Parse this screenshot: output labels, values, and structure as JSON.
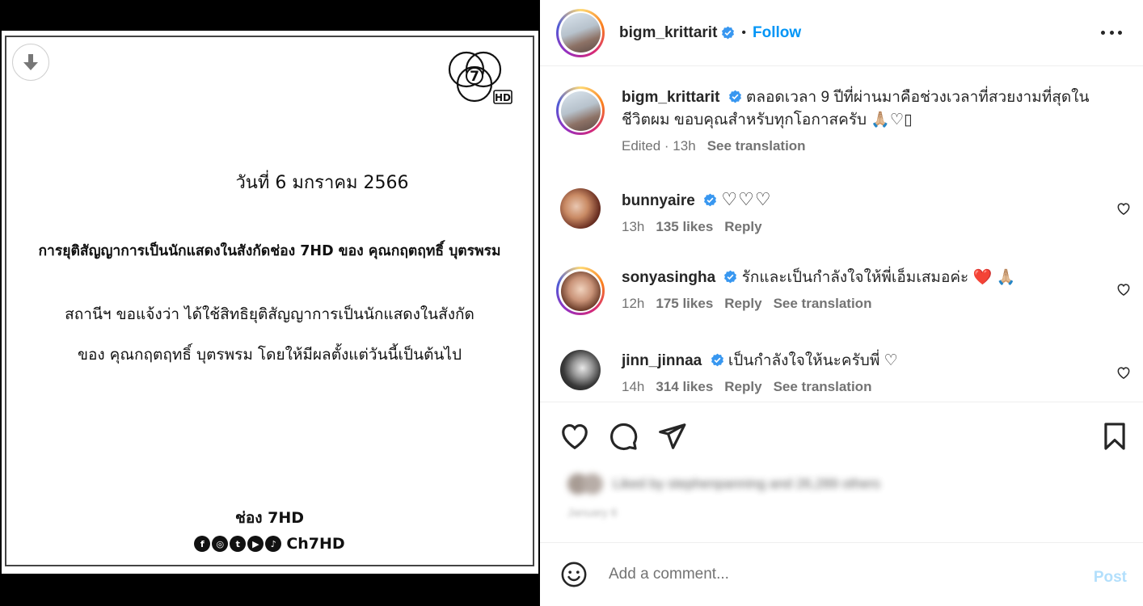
{
  "media": {
    "download_icon": "arrow-down-icon",
    "logo_text": "7",
    "logo_sub": "HD",
    "date_line": "วันที่ 6 มกราคม 2566",
    "heading": "การยุติสัญญาการเป็นนักแสดงในสังกัดช่อง 7HD ของ คุณกฤตฤทธิ์ บุตรพรม",
    "body_line_1": "สถานีฯ ขอแจ้งว่า ได้ใช้สิทธิยุติสัญญาการเป็นนักแสดงในสังกัด",
    "body_line_2": "ของ คุณกฤตฤทธิ์ บุตรพรม โดยให้มีผลตั้งแต่วันนี้เป็นต้นไป",
    "signature": "ช่อง 7HD",
    "social_icons": [
      {
        "name": "facebook-icon",
        "glyph": "f"
      },
      {
        "name": "instagram-icon",
        "glyph": "◎"
      },
      {
        "name": "twitter-icon",
        "glyph": "t"
      },
      {
        "name": "youtube-icon",
        "glyph": "▶"
      },
      {
        "name": "tiktok-icon",
        "glyph": "♪"
      }
    ],
    "social_handle": "Ch7HD"
  },
  "header": {
    "username": "bigm_krittarit",
    "separator": "•",
    "follow_label": "Follow"
  },
  "caption": {
    "username": "bigm_krittarit",
    "text": "ตลอดเวลา 9 ปีที่ผ่านมาคือช่วงเวลาที่สวยงามที่สุดในชีวิตผม ขอบคุณสำหรับทุกโอกาสครับ 🙏🏼♡▯",
    "edited": "Edited · 13h",
    "see_translation": "See translation"
  },
  "comments": [
    {
      "username": "bunnyaire",
      "text": "♡♡♡",
      "time": "13h",
      "likes": "135 likes",
      "reply": "Reply",
      "see_translation": ""
    },
    {
      "username": "sonyasingha",
      "text": "รักและเป็นกำลังใจให้พี่เอ็มเสมอค่ะ ❤️ 🙏🏼",
      "time": "12h",
      "likes": "175 likes",
      "reply": "Reply",
      "see_translation": "See translation"
    },
    {
      "username": "jinn_jinnaa",
      "text": "เป็นกำลังใจให้นะครับพี่ ♡",
      "time": "14h",
      "likes": "314 likes",
      "reply": "Reply",
      "see_translation": "See translation"
    }
  ],
  "likes_summary": "Liked by stephenpanning and 26,289 others",
  "post_date": "January 6",
  "composer": {
    "placeholder": "Add a comment...",
    "post_label": "Post"
  },
  "colors": {
    "accent": "#0095f6",
    "post_disabled": "#b2dffc",
    "verified": "#3897f0"
  }
}
